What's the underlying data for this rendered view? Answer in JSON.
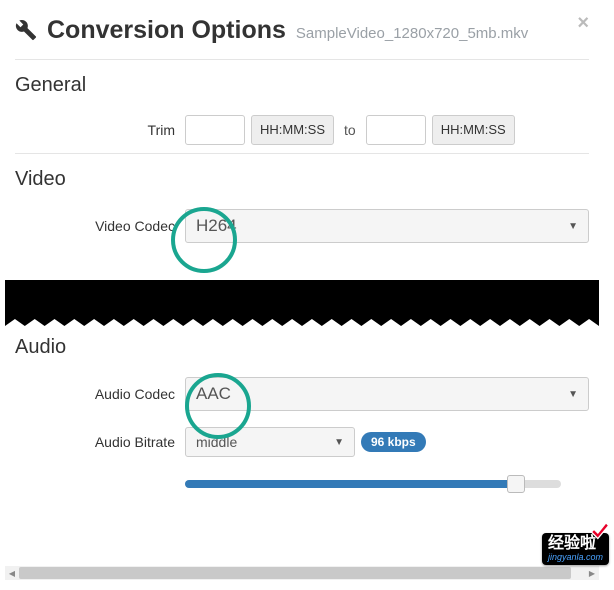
{
  "header": {
    "title": "Conversion Options",
    "filename": "SampleVideo_1280x720_5mb.mkv",
    "close": "×"
  },
  "general": {
    "heading": "General",
    "trim_label": "Trim",
    "from_placeholder": "HH:MM:SS",
    "to_sep": "to",
    "to_placeholder": "HH:MM:SS"
  },
  "video": {
    "heading": "Video",
    "codec_label": "Video Codec",
    "codec_value": "H264"
  },
  "audio": {
    "heading": "Audio",
    "codec_label": "Audio Codec",
    "codec_value": "AAC",
    "bitrate_label": "Audio Bitrate",
    "bitrate_value": "middle",
    "bitrate_badge": "96 kbps"
  },
  "watermark": {
    "zh": "经验啦",
    "py": "jingyanla.com"
  }
}
